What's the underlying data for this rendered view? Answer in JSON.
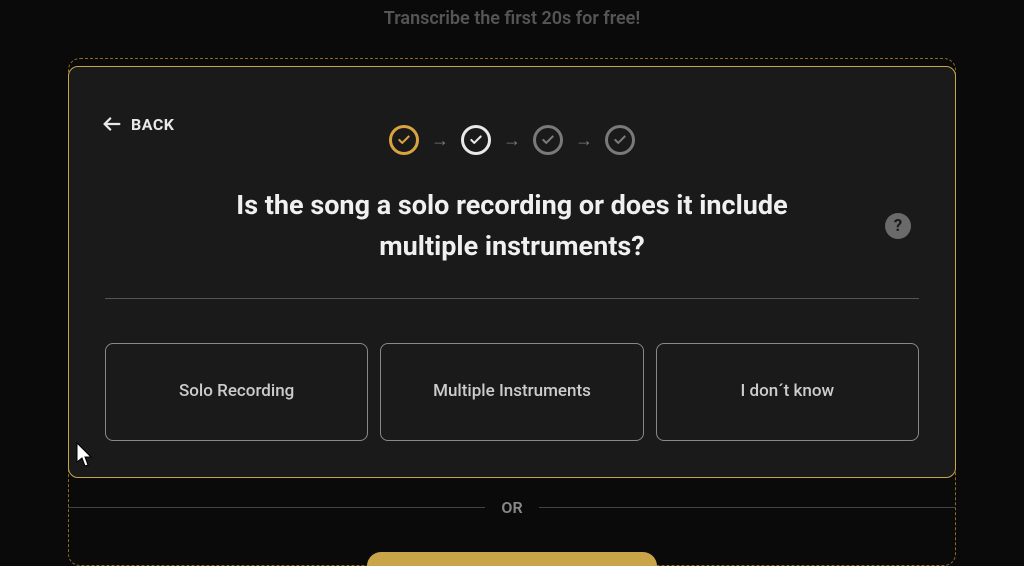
{
  "promo": "Transcribe the first 20s for free!",
  "back": {
    "label": "BACK"
  },
  "steps": {
    "count": 4,
    "states": [
      "completed",
      "current",
      "pending",
      "pending"
    ]
  },
  "question": "Is the song a solo recording or does it include multiple instruments?",
  "help": "?",
  "options": [
    {
      "label": "Solo Recording"
    },
    {
      "label": "Multiple Instruments"
    },
    {
      "label": "I don´t know"
    }
  ],
  "or": "OR"
}
